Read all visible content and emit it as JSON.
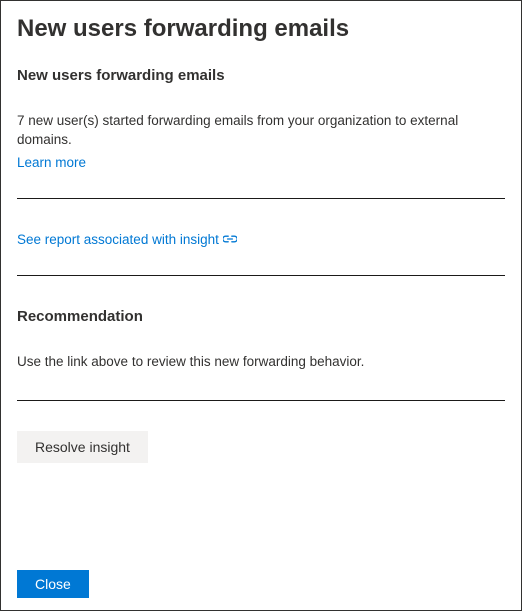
{
  "header": {
    "title": "New users forwarding emails"
  },
  "insight": {
    "heading": "New users forwarding emails",
    "description": "7 new user(s) started forwarding emails from your organization to external domains.",
    "learn_more_label": "Learn more",
    "report_link_label": "See report associated with insight"
  },
  "recommendation": {
    "heading": "Recommendation",
    "text": "Use the link above to review this new forwarding behavior."
  },
  "actions": {
    "resolve_label": "Resolve insight",
    "close_label": "Close"
  }
}
